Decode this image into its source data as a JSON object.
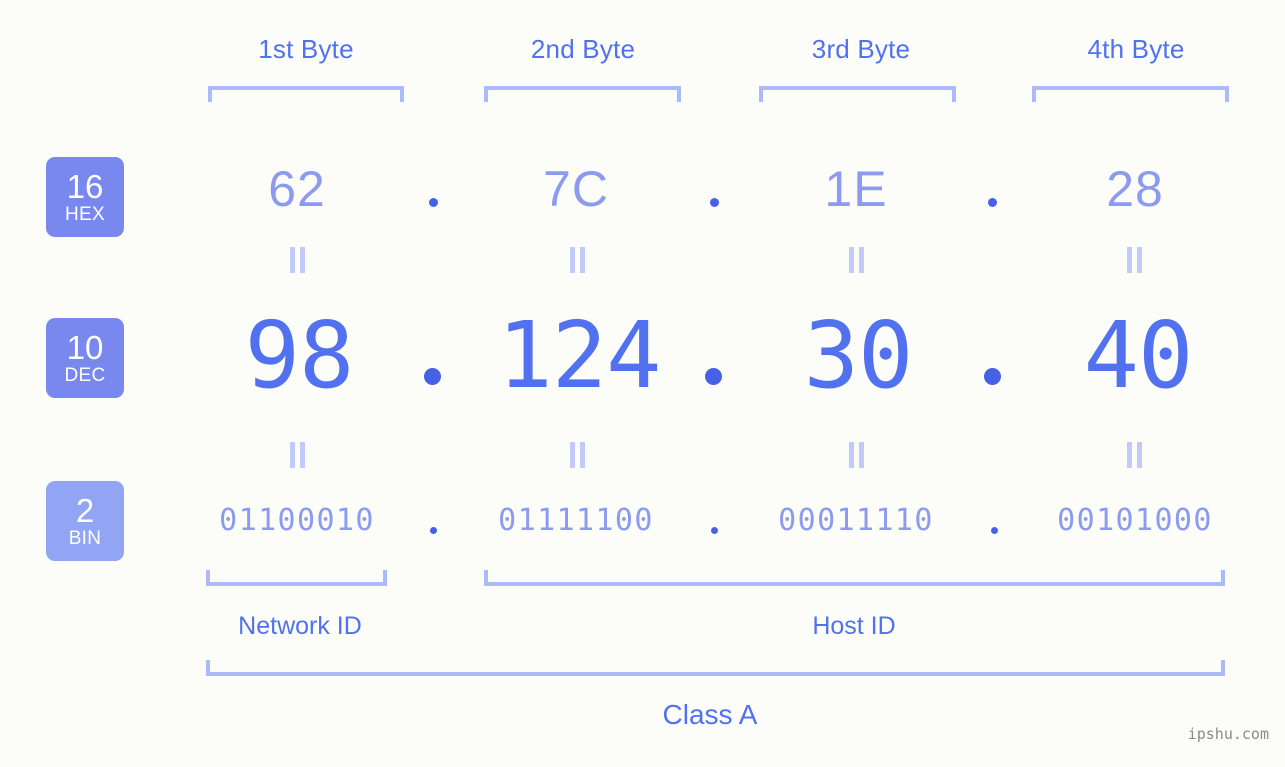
{
  "background_color": "#fcfdf8",
  "accent_colors": {
    "strong_blue": "#5271f0",
    "light_blue": "#8c9bf0",
    "bracket_blue": "#aeb9f7",
    "badge_hex": "#7888ee",
    "badge_dec": "#7888ee",
    "badge_bin": "#92a4f4",
    "eq_mark": "#c2cbf8",
    "watermark": "#8a8a8a"
  },
  "byte_headers": [
    {
      "label": "1st Byte"
    },
    {
      "label": "2nd Byte"
    },
    {
      "label": "3rd Byte"
    },
    {
      "label": "4th Byte"
    }
  ],
  "rows": [
    {
      "badge_number": "16",
      "badge_abbr": "HEX",
      "values": [
        "62",
        "7C",
        "1E",
        "28"
      ],
      "separator": "."
    },
    {
      "badge_number": "10",
      "badge_abbr": "DEC",
      "values": [
        "98",
        "124",
        "30",
        "40"
      ],
      "separator": "."
    },
    {
      "badge_number": "2",
      "badge_abbr": "BIN",
      "values": [
        "01100010",
        "01111100",
        "00011110",
        "00101000"
      ],
      "separator": "."
    }
  ],
  "equality_symbol": "=",
  "sections": [
    {
      "label": "Network ID"
    },
    {
      "label": "Host ID"
    }
  ],
  "class_label": "Class A",
  "watermark": "ipshu.com"
}
